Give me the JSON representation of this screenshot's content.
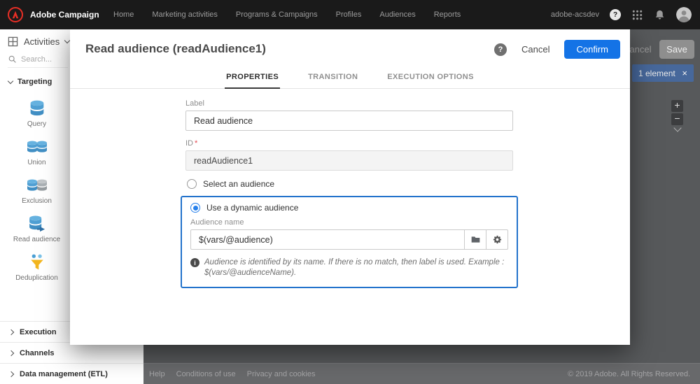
{
  "colors": {
    "accent": "#1473e6",
    "highlight_border": "#2373cc",
    "topbar_bg": "#1a1a1a",
    "icon_blue": "#4f9fd3",
    "funnel_yellow": "#f3b61f",
    "badge_bg": "#47689b",
    "required_mark": "#e34850"
  },
  "topbar": {
    "brand": "Adobe Campaign",
    "nav": [
      "Home",
      "Marketing activities",
      "Programs & Campaigns",
      "Profiles",
      "Audiences",
      "Reports"
    ],
    "account": "adobe-acsdev",
    "help_glyph": "?"
  },
  "sidebar": {
    "title": "Activities",
    "search_placeholder": "Search...",
    "sections": [
      {
        "label": "Targeting",
        "items": [
          {
            "label": "Query"
          },
          {
            "label": "Union"
          },
          {
            "label": "Exclusion"
          },
          {
            "label": "Read audience"
          },
          {
            "label": "Deduplication"
          }
        ]
      },
      {
        "label": "Execution"
      },
      {
        "label": "Channels"
      },
      {
        "label": "Data management (ETL)"
      }
    ]
  },
  "canvas": {
    "cancel_label": "Cancel",
    "save_label": "Save",
    "selection_badge": {
      "label": "1 element",
      "close_glyph": "×"
    },
    "zoom_in_glyph": "+",
    "zoom_out_glyph": "−"
  },
  "modal": {
    "title": "Read audience (readAudience1)",
    "help_glyph": "?",
    "cancel_label": "Cancel",
    "confirm_label": "Confirm",
    "tabs": [
      {
        "label": "PROPERTIES"
      },
      {
        "label": "TRANSITION"
      },
      {
        "label": "EXECUTION OPTIONS"
      }
    ],
    "form": {
      "label_field": {
        "label": "Label",
        "value": "Read audience"
      },
      "id_field": {
        "label": "ID",
        "required_mark": "*",
        "value": "readAudience1"
      },
      "radio_select_label": "Select an audience",
      "radio_dynamic_label": "Use a dynamic audience",
      "audience_field": {
        "label": "Audience name",
        "value": "$(vars/@audience)"
      },
      "note": "Audience is identified by its name. If there is no match, then label is used. Example : $(vars/@audienceName)."
    }
  },
  "footer": {
    "links": [
      "Help",
      "Conditions of use",
      "Privacy and cookies"
    ],
    "copyright": "© 2019 Adobe. All Rights Reserved."
  }
}
